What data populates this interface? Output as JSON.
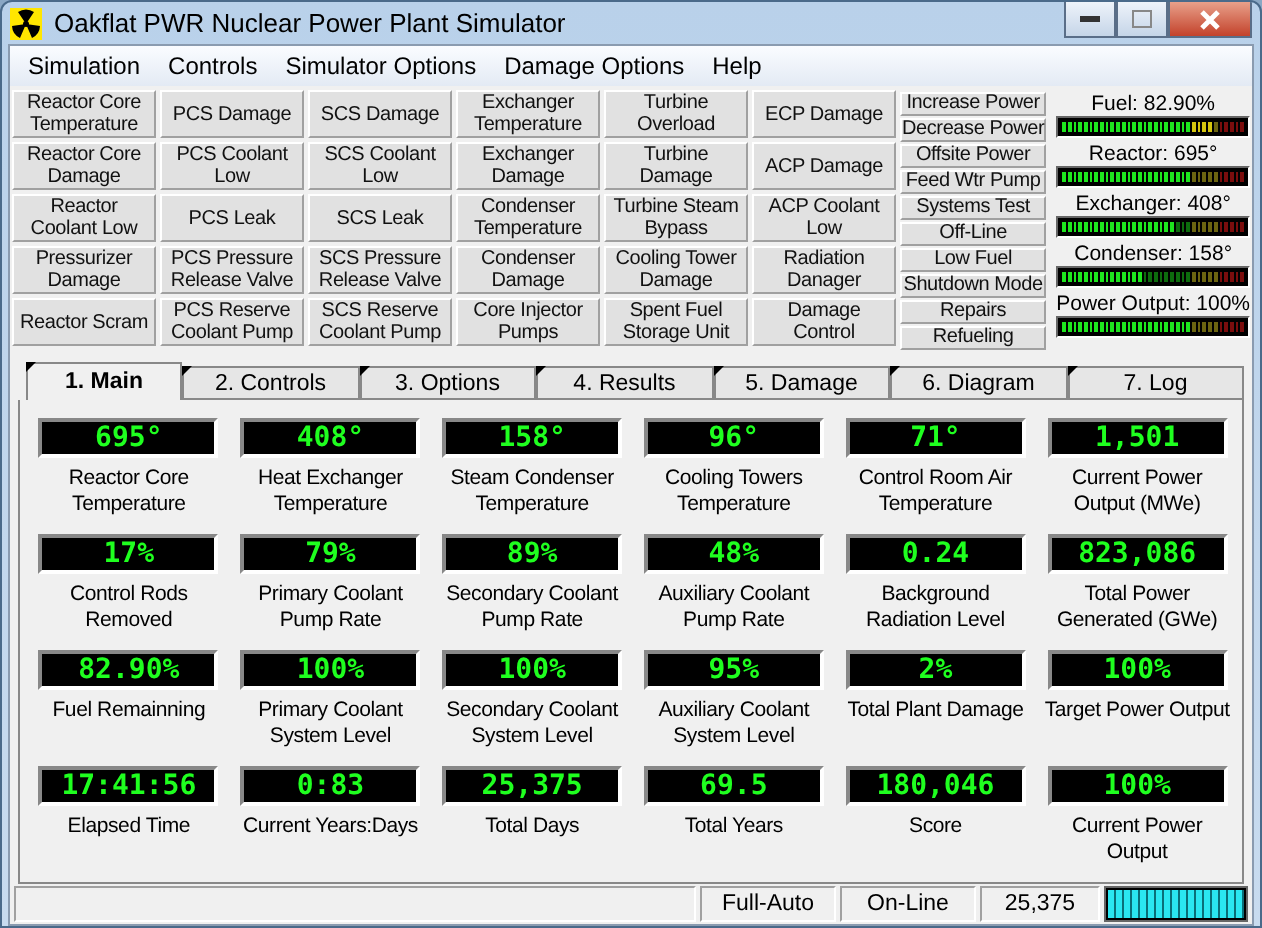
{
  "window": {
    "title": "Oakflat PWR Nuclear Power Plant Simulator"
  },
  "menu": [
    "Simulation",
    "Controls",
    "Simulator Options",
    "Damage Options",
    "Help"
  ],
  "alarm_columns": [
    [
      "Reactor Core Temperature",
      "Reactor Core Damage",
      "Reactor Coolant Low",
      "Pressurizer Damage",
      "Reactor Scram"
    ],
    [
      "PCS Damage",
      "PCS Coolant Low",
      "PCS Leak",
      "PCS Pressure Release Valve",
      "PCS Reserve Coolant Pump"
    ],
    [
      "SCS Damage",
      "SCS Coolant Low",
      "SCS Leak",
      "SCS Pressure Release Valve",
      "SCS Reserve Coolant Pump"
    ],
    [
      "Exchanger Temperature",
      "Exchanger Damage",
      "Condenser Temperature",
      "Condenser Damage",
      "Core Injector Pumps"
    ],
    [
      "Turbine Overload",
      "Turbine Damage",
      "Turbine Steam Bypass",
      "Cooling Tower Damage",
      "Spent Fuel Storage Unit"
    ],
    [
      "ECP Damage",
      "ACP Damage",
      "ACP Coolant Low",
      "Radiation Danager",
      "Damage Control"
    ]
  ],
  "small_buttons": [
    "Increase Power",
    "Decrease Power",
    "Offsite Power",
    "Feed Wtr Pump",
    "Systems Test",
    "Off-Line",
    "Low Fuel",
    "Shutdown Mode",
    "Repairs",
    "Refueling"
  ],
  "meters": [
    {
      "label": "Fuel: 82.90%",
      "level": 0.83
    },
    {
      "label": "Reactor: 695°",
      "level": 0.72
    },
    {
      "label": "Exchanger: 408°",
      "level": 0.62
    },
    {
      "label": "Condenser: 158°",
      "level": 0.45
    },
    {
      "label": "Power Output: 100%",
      "level": 0.72
    }
  ],
  "tabs": [
    {
      "label": "1. Main",
      "selected": true
    },
    {
      "label": "2. Controls",
      "selected": false
    },
    {
      "label": "3. Options",
      "selected": false
    },
    {
      "label": "4. Results",
      "selected": false
    },
    {
      "label": "5. Damage",
      "selected": false
    },
    {
      "label": "6. Diagram",
      "selected": false
    },
    {
      "label": "7. Log",
      "selected": false
    }
  ],
  "readouts": [
    {
      "value": "695°",
      "label": "Reactor Core Temperature"
    },
    {
      "value": "408°",
      "label": "Heat Exchanger Temperature"
    },
    {
      "value": "158°",
      "label": "Steam Condenser Temperature"
    },
    {
      "value": "96°",
      "label": "Cooling Towers Temperature"
    },
    {
      "value": "71°",
      "label": "Control Room Air Temperature"
    },
    {
      "value": "1,501",
      "label": "Current Power Output (MWe)"
    },
    {
      "value": "17%",
      "label": "Control Rods Removed"
    },
    {
      "value": "79%",
      "label": "Primary Coolant Pump Rate"
    },
    {
      "value": "89%",
      "label": "Secondary Coolant Pump Rate"
    },
    {
      "value": "48%",
      "label": "Auxiliary Coolant Pump Rate"
    },
    {
      "value": "0.24",
      "label": "Background Radiation Level"
    },
    {
      "value": "823,086",
      "label": "Total Power Generated (GWe)"
    },
    {
      "value": "82.90%",
      "label": "Fuel Remainning"
    },
    {
      "value": "100%",
      "label": "Primary Coolant System Level"
    },
    {
      "value": "100%",
      "label": "Secondary Coolant System Level"
    },
    {
      "value": "95%",
      "label": "Auxiliary Coolant System Level"
    },
    {
      "value": "2%",
      "label": "Total Plant Damage"
    },
    {
      "value": "100%",
      "label": "Target Power Output"
    },
    {
      "value": "17:41:56",
      "label": "Elapsed Time"
    },
    {
      "value": "0:83",
      "label": "Current Years:Days"
    },
    {
      "value": "25,375",
      "label": "Total Days"
    },
    {
      "value": "69.5",
      "label": "Total Years"
    },
    {
      "value": "180,046",
      "label": "Score"
    },
    {
      "value": "100%",
      "label": "Current Power Output"
    }
  ],
  "status_bar": {
    "panels": [
      "Full-Auto",
      "On-Line",
      "25,375"
    ],
    "progress": {
      "level": 1
    }
  }
}
